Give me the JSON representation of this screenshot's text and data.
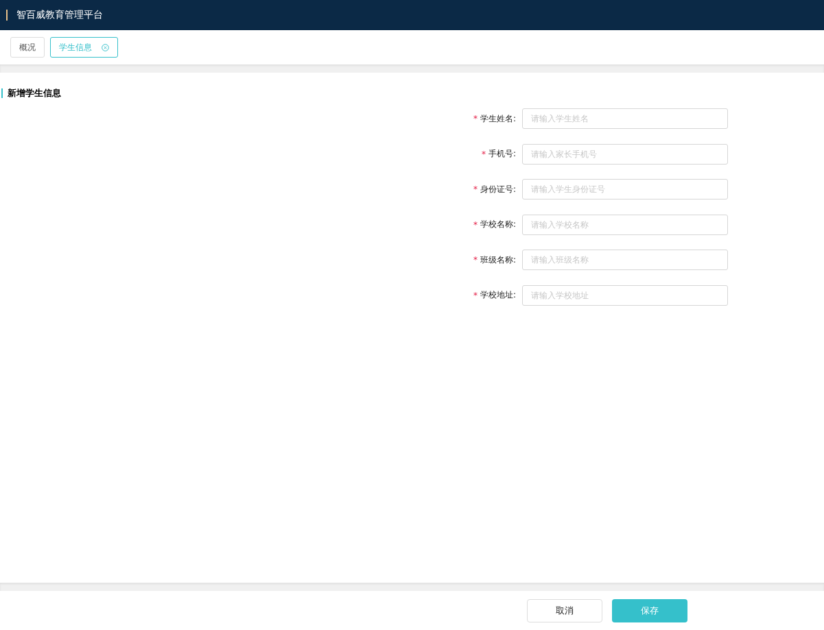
{
  "header": {
    "title": "智百威教育管理平台"
  },
  "tabs": [
    {
      "label": "概况",
      "selected": false,
      "closable": false
    },
    {
      "label": "学生信息",
      "selected": true,
      "closable": true
    }
  ],
  "section": {
    "title": "新增学生信息"
  },
  "fields": [
    {
      "required_mark": "*",
      "label": "学生姓名:",
      "placeholder": "请输入学生姓名"
    },
    {
      "required_mark": "*",
      "label": "手机号:",
      "placeholder": "请输入家长手机号"
    },
    {
      "required_mark": "*",
      "label": "身份证号:",
      "placeholder": "请输入学生身份证号"
    },
    {
      "required_mark": "*",
      "label": "学校名称:",
      "placeholder": "请输入学校名称"
    },
    {
      "required_mark": "*",
      "label": "班级名称:",
      "placeholder": "请输入班级名称"
    },
    {
      "required_mark": "*",
      "label": "学校地址:",
      "placeholder": "请输入学校地址"
    }
  ],
  "buttons": [
    {
      "label": "取消",
      "kind": "secondary"
    },
    {
      "label": "保存",
      "kind": "primary"
    }
  ]
}
